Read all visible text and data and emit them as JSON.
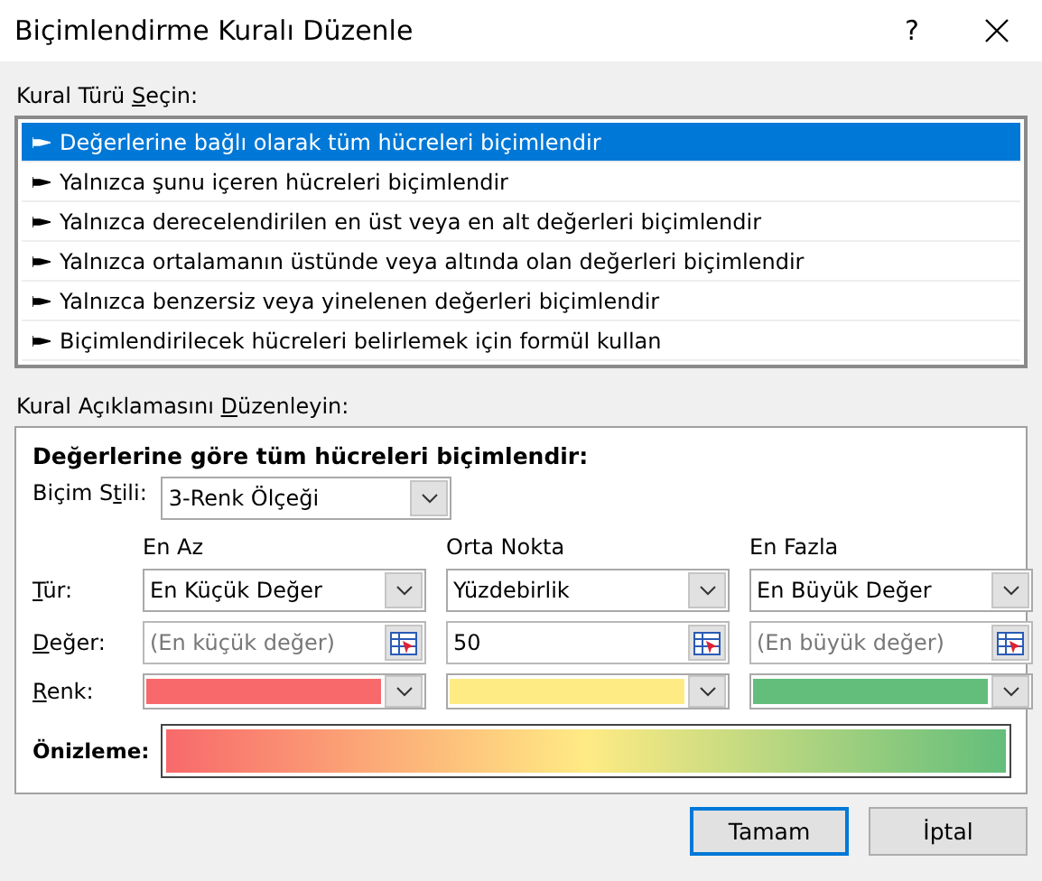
{
  "window": {
    "title": "Biçimlendirme Kuralı Düzenle",
    "help": "?"
  },
  "rule_type": {
    "label_parts": [
      "Kural Türü ",
      "S",
      "eçin:"
    ],
    "items": [
      {
        "label": "Değerlerine bağlı olarak tüm hücreleri biçimlendir",
        "selected": true
      },
      {
        "label": "Yalnızca şunu içeren hücreleri biçimlendir",
        "selected": false
      },
      {
        "label": "Yalnızca derecelendirilen en üst veya en alt değerleri biçimlendir",
        "selected": false
      },
      {
        "label": "Yalnızca ortalamanın üstünde veya altında olan değerleri biçimlendir",
        "selected": false
      },
      {
        "label": "Yalnızca benzersiz veya yinelenen değerleri biçimlendir",
        "selected": false
      },
      {
        "label": "Biçimlendirilecek hücreleri belirlemek için formül kullan",
        "selected": false
      }
    ]
  },
  "description": {
    "label_parts": [
      "Kural Açıklamasını ",
      "D",
      "üzenleyin:"
    ],
    "heading": "Değerlerine göre tüm hücreleri biçimlendir:",
    "format_style": {
      "label_parts": [
        "Biçim S",
        "t",
        "ili:"
      ],
      "value": "3-Renk Ölçeği"
    },
    "type_label": {
      "key": "T",
      "rest": "ür:"
    },
    "value_label": {
      "key": "D",
      "rest": "eğer:"
    },
    "swatch_label": {
      "key": "R",
      "rest": "enk:"
    },
    "columns": [
      {
        "header": "En Az",
        "type": "En Küçük Değer",
        "placeholder": "(En küçük değer)",
        "color": "#f8696b"
      },
      {
        "header": "Orta Nokta",
        "type": "Yüzdebirlik",
        "value": "50",
        "color": "#ffeb84"
      },
      {
        "header": "En Fazla",
        "type": "En Büyük Değer",
        "placeholder": "(En büyük değer)",
        "color": "#63be7b"
      }
    ],
    "preview_label": "Önizleme:"
  },
  "buttons": [
    {
      "label": "Tamam",
      "default": true
    },
    {
      "label": "İptal",
      "default": false
    }
  ]
}
